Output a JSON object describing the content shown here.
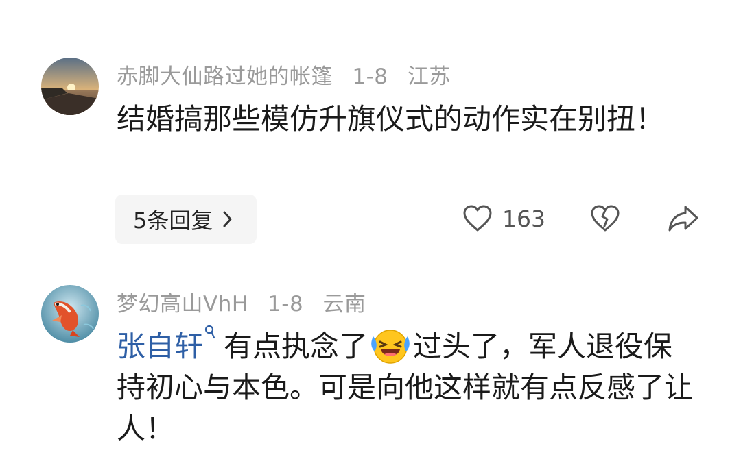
{
  "comments": [
    {
      "username": "赤脚大仙路过她的帐篷",
      "date": "1-8",
      "location": "江苏",
      "text": "结婚搞那些模仿升旗仪式的动作实在别扭！",
      "replies_label": "5条回复",
      "like_count": "163",
      "avatar": "sunset-lake-avatar"
    },
    {
      "username": "梦幻高山VhH",
      "date": "1-8",
      "location": "云南",
      "mention": "张自轩",
      "text_before_emoji": "有点执念了",
      "emoji": "laughing-crying-emoji",
      "text_after_emoji": "过头了，军人退役保持初心与本色。可是向他这样就有点反感了让人！",
      "avatar": "koi-fish-avatar"
    }
  ],
  "colors": {
    "meta_gray": "#9a9a9a",
    "mention_blue": "#2e5fa6",
    "reply_button_bg": "#f5f5f5"
  }
}
